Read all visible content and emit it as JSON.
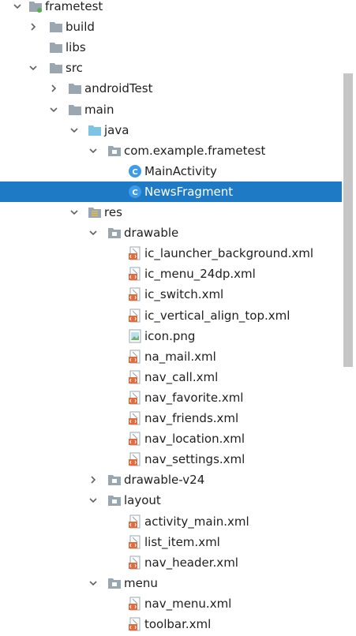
{
  "tree": {
    "rows": [
      {
        "label": "frametest",
        "icon": "module-folder-icon",
        "expanded": true,
        "selected": false
      },
      {
        "label": "build",
        "icon": "folder-icon",
        "expanded": false,
        "selected": false
      },
      {
        "label": "libs",
        "icon": "folder-icon",
        "expanded": null,
        "selected": false
      },
      {
        "label": "src",
        "icon": "folder-icon",
        "expanded": true,
        "selected": false
      },
      {
        "label": "androidTest",
        "icon": "folder-icon",
        "expanded": false,
        "selected": false
      },
      {
        "label": "main",
        "icon": "folder-icon",
        "expanded": true,
        "selected": false
      },
      {
        "label": "java",
        "icon": "source-folder-icon",
        "expanded": true,
        "selected": false
      },
      {
        "label": "com.example.frametest",
        "icon": "package-icon",
        "expanded": true,
        "selected": false
      },
      {
        "label": "MainActivity",
        "icon": "class-icon",
        "expanded": null,
        "selected": false
      },
      {
        "label": "NewsFragment",
        "icon": "class-icon",
        "expanded": null,
        "selected": true
      },
      {
        "label": "res",
        "icon": "resource-folder-icon",
        "expanded": true,
        "selected": false
      },
      {
        "label": "drawable",
        "icon": "package-icon",
        "expanded": true,
        "selected": false
      },
      {
        "label": "ic_launcher_background.xml",
        "icon": "xml-file-icon",
        "expanded": null,
        "selected": false
      },
      {
        "label": "ic_menu_24dp.xml",
        "icon": "xml-file-icon",
        "expanded": null,
        "selected": false
      },
      {
        "label": "ic_switch.xml",
        "icon": "xml-file-icon",
        "expanded": null,
        "selected": false
      },
      {
        "label": "ic_vertical_align_top.xml",
        "icon": "xml-file-icon",
        "expanded": null,
        "selected": false
      },
      {
        "label": "icon.png",
        "icon": "image-file-icon",
        "expanded": null,
        "selected": false
      },
      {
        "label": "na_mail.xml",
        "icon": "xml-file-icon",
        "expanded": null,
        "selected": false
      },
      {
        "label": "nav_call.xml",
        "icon": "xml-file-icon",
        "expanded": null,
        "selected": false
      },
      {
        "label": "nav_favorite.xml",
        "icon": "xml-file-icon",
        "expanded": null,
        "selected": false
      },
      {
        "label": "nav_friends.xml",
        "icon": "xml-file-icon",
        "expanded": null,
        "selected": false
      },
      {
        "label": "nav_location.xml",
        "icon": "xml-file-icon",
        "expanded": null,
        "selected": false
      },
      {
        "label": "nav_settings.xml",
        "icon": "xml-file-icon",
        "expanded": null,
        "selected": false
      },
      {
        "label": "drawable-v24",
        "icon": "package-icon",
        "expanded": false,
        "selected": false
      },
      {
        "label": "layout",
        "icon": "package-icon",
        "expanded": true,
        "selected": false
      },
      {
        "label": "activity_main.xml",
        "icon": "xml-file-icon",
        "expanded": null,
        "selected": false
      },
      {
        "label": "list_item.xml",
        "icon": "xml-file-icon",
        "expanded": null,
        "selected": false
      },
      {
        "label": "nav_header.xml",
        "icon": "xml-file-icon",
        "expanded": null,
        "selected": false
      },
      {
        "label": "menu",
        "icon": "package-icon",
        "expanded": true,
        "selected": false
      },
      {
        "label": "nav_menu.xml",
        "icon": "xml-file-icon",
        "expanded": null,
        "selected": false
      },
      {
        "label": "toolbar.xml",
        "icon": "xml-file-icon",
        "expanded": null,
        "selected": false
      }
    ]
  },
  "colors": {
    "selection": "#1f7ac5",
    "folder": "#9aa7b0",
    "source_folder": "#7dc4e4",
    "class_badge": "#3d9be9",
    "xml_badge": "#e06b3c"
  }
}
